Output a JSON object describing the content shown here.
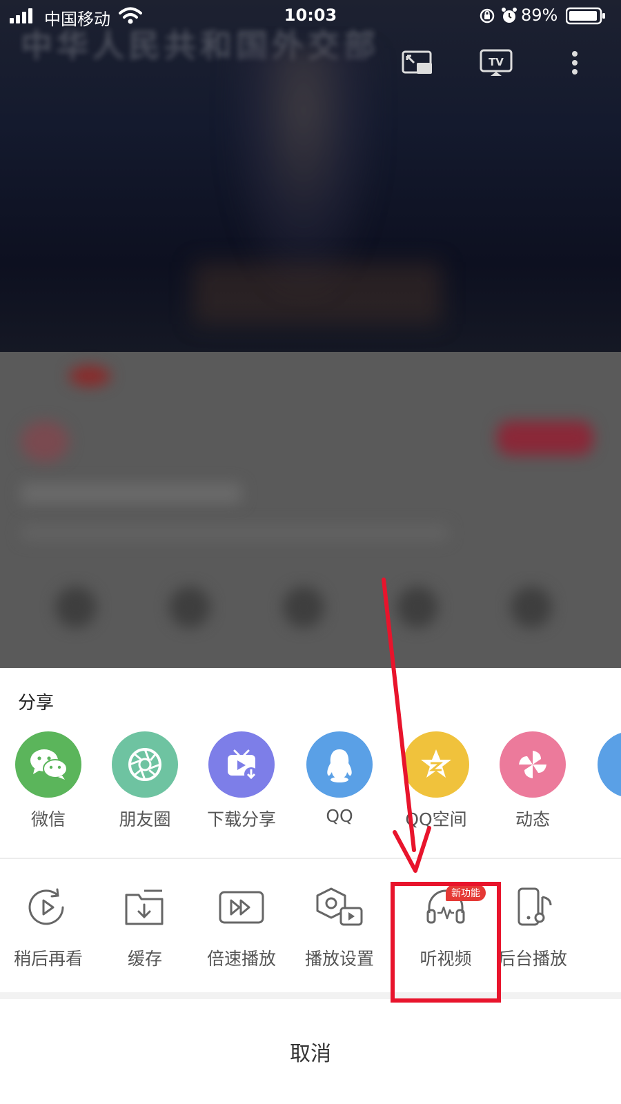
{
  "status_bar": {
    "carrier": "中国移动",
    "time": "10:03",
    "battery": "89%"
  },
  "video": {
    "background_title": "中华人民共和国外交部",
    "overlay_icons": [
      "pip-icon",
      "tv-cast-icon",
      "more-icon"
    ],
    "tv_label": "TV"
  },
  "share_sheet": {
    "title": "分享",
    "share_items": [
      {
        "label": "微信",
        "icon": "wechat-icon",
        "color": "#5bb55b"
      },
      {
        "label": "朋友圈",
        "icon": "moments-icon",
        "color": "#6ec3a1"
      },
      {
        "label": "下载分享",
        "icon": "download-share-icon",
        "color": "#7d7ee8"
      },
      {
        "label": "QQ",
        "icon": "qq-icon",
        "color": "#5aa0e6"
      },
      {
        "label": "QQ空间",
        "icon": "qzone-icon",
        "color": "#f0c23c"
      },
      {
        "label": "动态",
        "icon": "dynamic-icon",
        "color": "#ec7a9b"
      }
    ],
    "action_items": [
      {
        "label": "稍后再看",
        "icon": "watch-later-icon"
      },
      {
        "label": "缓存",
        "icon": "cache-icon"
      },
      {
        "label": "倍速播放",
        "icon": "speed-play-icon"
      },
      {
        "label": "播放设置",
        "icon": "play-settings-icon"
      },
      {
        "label": "听视频",
        "icon": "listen-video-icon"
      },
      {
        "label": "后台播放",
        "icon": "background-play-icon"
      }
    ],
    "new_badge": "新功能",
    "cancel_label": "取消"
  },
  "colors": {
    "annotation_red": "#e8142c",
    "badge_red": "#e53935"
  }
}
